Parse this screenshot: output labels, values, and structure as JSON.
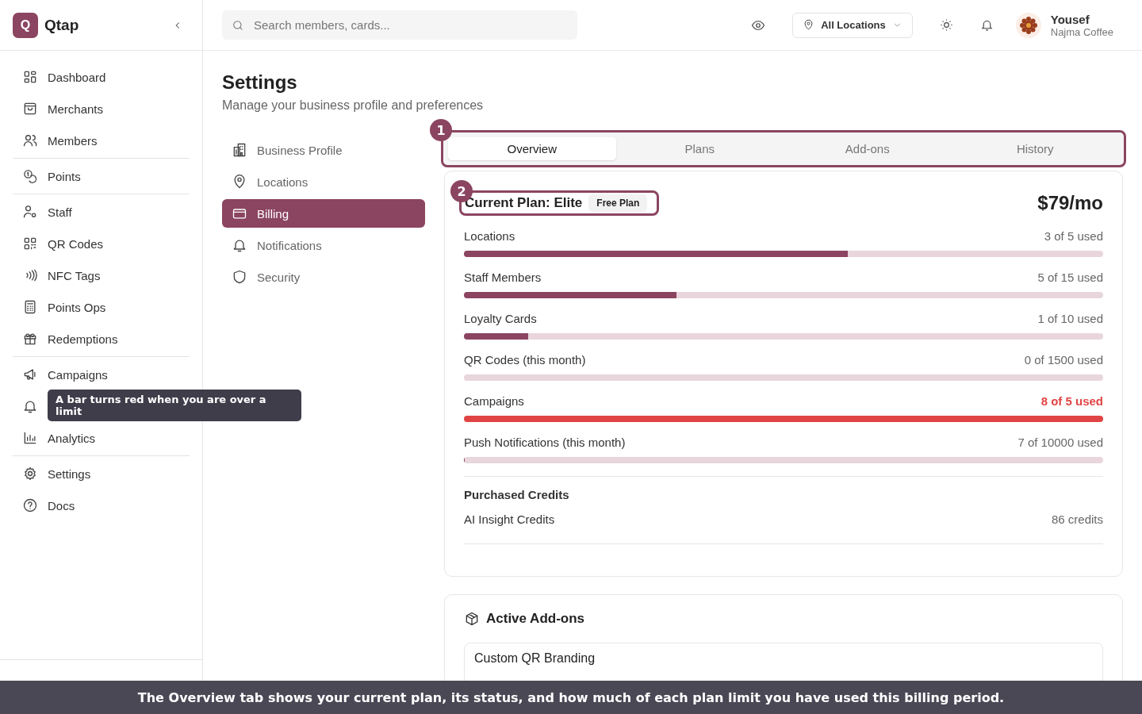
{
  "app": {
    "logo_letter": "Q",
    "name": "Qtap"
  },
  "search": {
    "placeholder": "Search members, cards..."
  },
  "location_select": {
    "value": "All Locations"
  },
  "user": {
    "name": "Yousef",
    "business": "Najma Coffee"
  },
  "sidebar": {
    "groups": [
      {
        "items": [
          {
            "label": "Dashboard"
          },
          {
            "label": "Merchants"
          },
          {
            "label": "Members"
          }
        ]
      },
      {
        "items": [
          {
            "label": "Points"
          }
        ]
      },
      {
        "items": [
          {
            "label": "Staff"
          },
          {
            "label": "QR Codes"
          },
          {
            "label": "NFC Tags"
          },
          {
            "label": "Points Ops"
          },
          {
            "label": "Redemptions"
          }
        ]
      },
      {
        "items": [
          {
            "label": "Campaigns"
          },
          {
            "kind": "covered"
          },
          {
            "label": "Analytics"
          }
        ]
      },
      {
        "items": [
          {
            "label": "Settings"
          },
          {
            "label": "Docs"
          }
        ]
      }
    ]
  },
  "page": {
    "title": "Settings",
    "subtitle": "Manage your business profile and preferences"
  },
  "settings_nav": [
    {
      "label": "Business Profile",
      "selected": false
    },
    {
      "label": "Locations",
      "selected": false
    },
    {
      "label": "Billing",
      "selected": true
    },
    {
      "label": "Notifications",
      "selected": false
    },
    {
      "label": "Security",
      "selected": false
    }
  ],
  "tabs": [
    {
      "label": "Overview",
      "selected": true
    },
    {
      "label": "Plans",
      "selected": false
    },
    {
      "label": "Add-ons",
      "selected": false
    },
    {
      "label": "History",
      "selected": false
    }
  ],
  "plan": {
    "title": "Current Plan: Elite",
    "badge": "Free Plan",
    "price": "$79/mo"
  },
  "usage": [
    {
      "name": "Locations",
      "reading": "3 of 5 used",
      "level": 0.6,
      "over": false
    },
    {
      "name": "Staff Members",
      "reading": "5 of 15 used",
      "level": 0.333,
      "over": false
    },
    {
      "name": "Loyalty Cards",
      "reading": "1 of 10 used",
      "level": 0.1,
      "over": false
    },
    {
      "name": "QR Codes (this month)",
      "reading": "0 of 1500 used",
      "level": 0,
      "over": false
    },
    {
      "name": "Campaigns",
      "reading": "8 of 5 used",
      "level": 1,
      "over": true
    },
    {
      "name": "Push Notifications (this month)",
      "reading": "7 of 10000 used",
      "level": 0.0007,
      "over": false
    }
  ],
  "credits": {
    "title": "Purchased Credits",
    "items": [
      {
        "name": "AI Insight Credits",
        "reading": "86 credits"
      }
    ]
  },
  "addons": {
    "title": "Active Add-ons",
    "items": [
      {
        "name": "Custom QR Branding"
      }
    ]
  },
  "tutorial": {
    "callouts": [
      "1",
      "2"
    ],
    "tooltip": "A bar turns red when you are over a limit",
    "caption": "The Overview tab shows your current plan, its status, and how much of each plan limit you have used this billing period."
  }
}
